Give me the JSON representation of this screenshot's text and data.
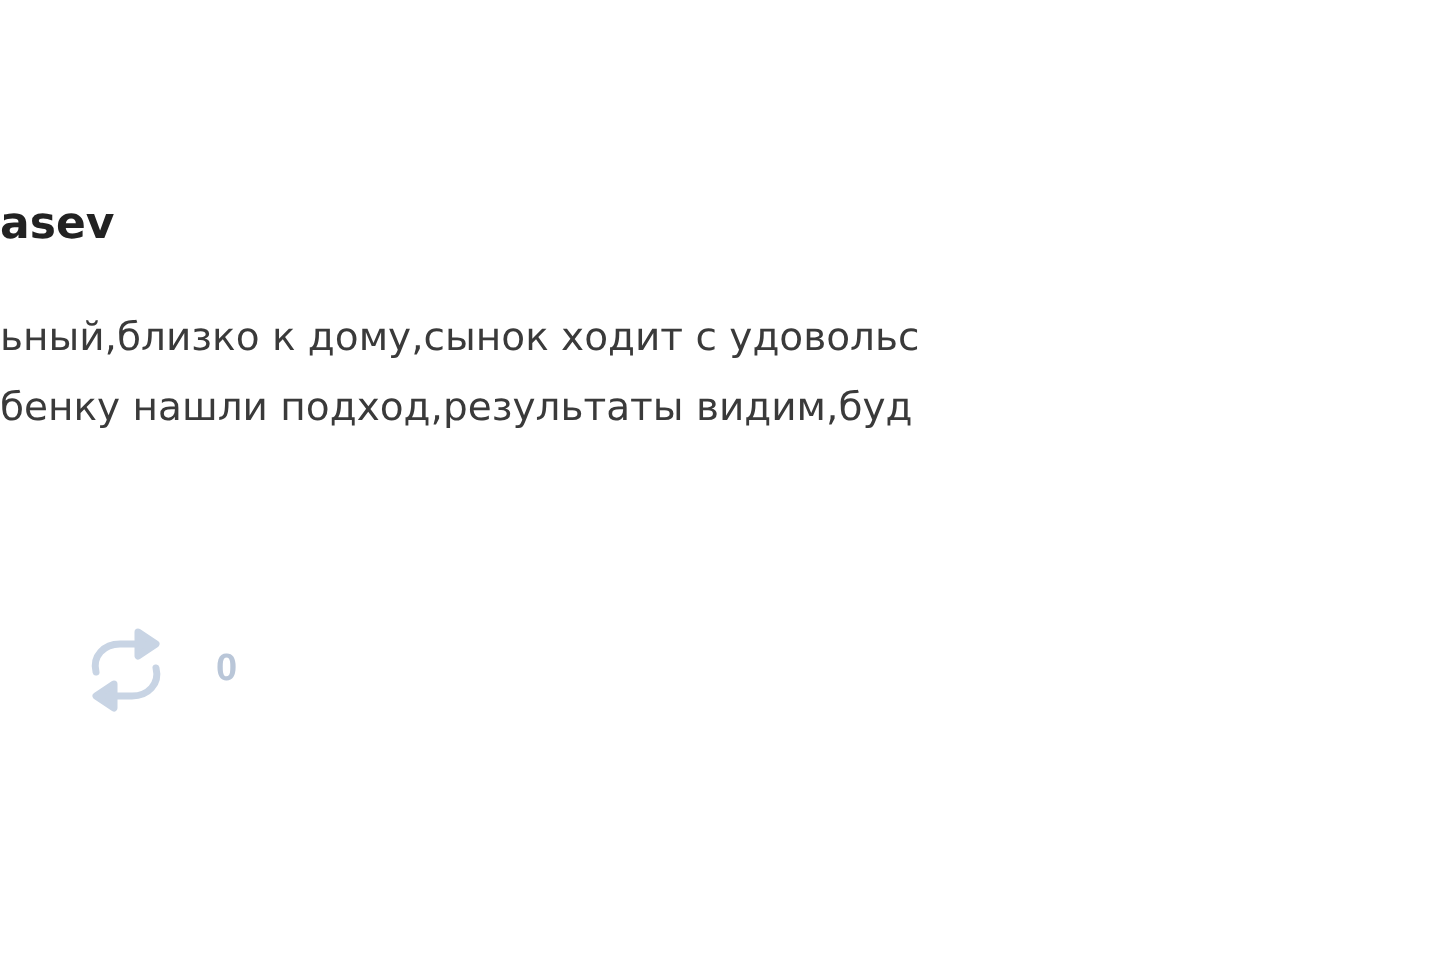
{
  "post": {
    "author": "asev",
    "text_lines": [
      "ьный,близко к дому,сынок ходит с удовольс",
      "бенку нашли подход,результаты видим,буд"
    ],
    "actions": [
      {
        "kind": "repost",
        "count": "0"
      }
    ]
  }
}
